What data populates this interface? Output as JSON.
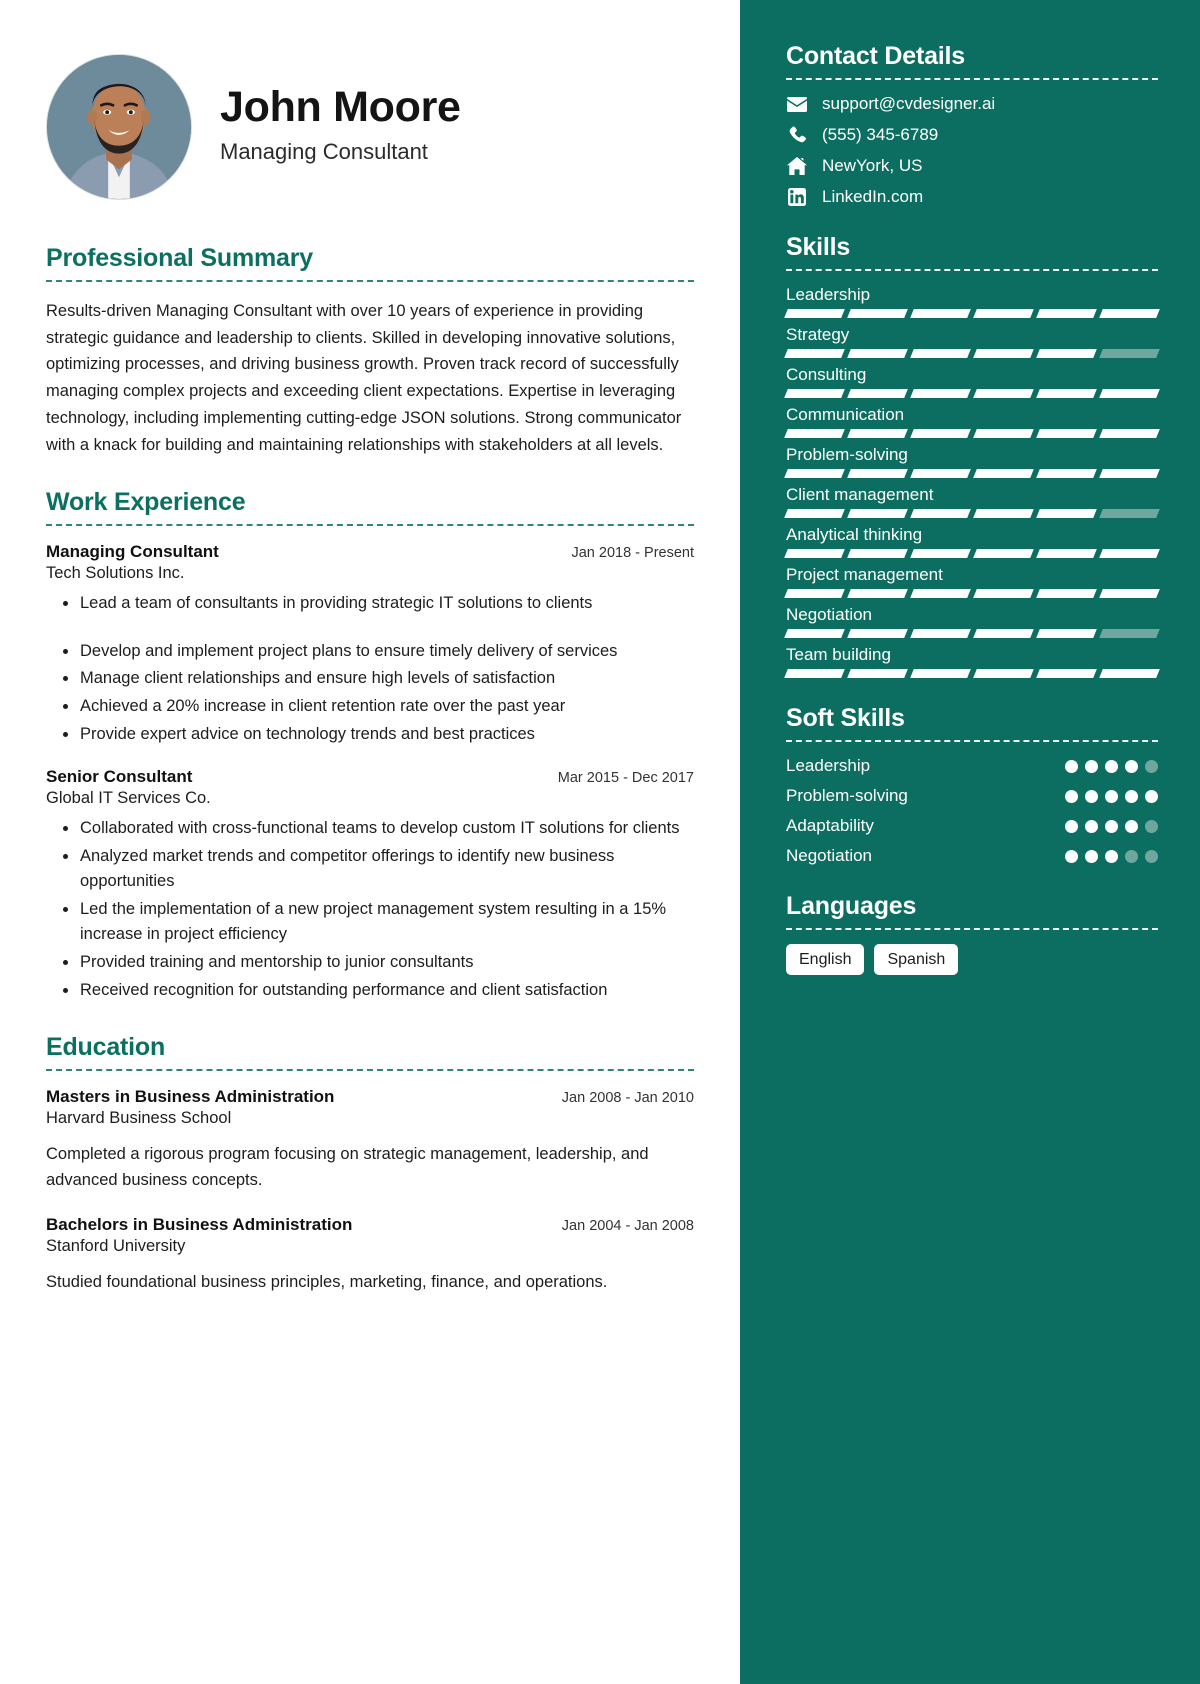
{
  "profile": {
    "name": "John Moore",
    "title": "Managing Consultant",
    "avatar_icon": "person-photo"
  },
  "summary": {
    "heading": "Professional Summary",
    "text": "Results-driven Managing Consultant with over 10 years of experience in providing strategic guidance and leadership to clients. Skilled in developing innovative solutions, optimizing processes, and driving business growth. Proven track record of successfully managing complex projects and exceeding client expectations. Expertise in leveraging technology, including implementing cutting-edge JSON solutions. Strong communicator with a knack for building and maintaining relationships with stakeholders at all levels."
  },
  "work": {
    "heading": "Work Experience",
    "jobs": [
      {
        "role": "Managing Consultant",
        "company": "Tech Solutions Inc.",
        "dates": "Jan 2018 - Present",
        "bullets": [
          "Lead a team of consultants in providing strategic IT solutions to clients",
          "Develop and implement project plans to ensure timely delivery of services",
          "Manage client relationships and ensure high levels of satisfaction",
          "Achieved a 20% increase in client retention rate over the past year",
          "Provide expert advice on technology trends and best practices"
        ]
      },
      {
        "role": "Senior Consultant",
        "company": "Global IT Services Co.",
        "dates": "Mar 2015 - Dec 2017",
        "bullets": [
          "Collaborated with cross-functional teams to develop custom IT solutions for clients",
          "Analyzed market trends and competitor offerings to identify new business opportunities",
          "Led the implementation of a new project management system resulting in a 15% increase in project efficiency",
          "Provided training and mentorship to junior consultants",
          "Received recognition for outstanding performance and client satisfaction"
        ]
      }
    ]
  },
  "education": {
    "heading": "Education",
    "items": [
      {
        "degree": "Masters in Business Administration",
        "school": "Harvard Business School",
        "dates": "Jan 2008 - Jan 2010",
        "description": "Completed a rigorous program focusing on strategic management, leadership, and advanced business concepts."
      },
      {
        "degree": "Bachelors in Business Administration",
        "school": "Stanford University",
        "dates": "Jan 2004 - Jan 2008",
        "description": "Studied foundational business principles, marketing, finance, and operations."
      }
    ]
  },
  "contact": {
    "heading": "Contact Details",
    "items": [
      {
        "icon": "envelope-icon",
        "value": "support@cvdesigner.ai"
      },
      {
        "icon": "phone-icon",
        "value": "(555) 345-6789"
      },
      {
        "icon": "home-icon",
        "value": "NewYork, US"
      },
      {
        "icon": "linkedin-icon",
        "value": "LinkedIn.com"
      }
    ]
  },
  "skills": {
    "heading": "Skills",
    "segments_total": 6,
    "items": [
      {
        "name": "Leadership",
        "filled": 6
      },
      {
        "name": "Strategy",
        "filled": 5
      },
      {
        "name": "Consulting",
        "filled": 6
      },
      {
        "name": "Communication",
        "filled": 6
      },
      {
        "name": "Problem-solving",
        "filled": 6
      },
      {
        "name": "Client management",
        "filled": 5
      },
      {
        "name": "Analytical thinking",
        "filled": 6
      },
      {
        "name": "Project management",
        "filled": 6
      },
      {
        "name": "Negotiation",
        "filled": 5
      },
      {
        "name": "Team building",
        "filled": 6
      }
    ]
  },
  "soft_skills": {
    "heading": "Soft Skills",
    "dots_total": 5,
    "items": [
      {
        "name": "Leadership",
        "rating": 4
      },
      {
        "name": "Problem-solving",
        "rating": 5
      },
      {
        "name": "Adaptability",
        "rating": 4
      },
      {
        "name": "Negotiation",
        "rating": 3
      }
    ]
  },
  "languages": {
    "heading": "Languages",
    "items": [
      "English",
      "Spanish"
    ]
  },
  "colors": {
    "accent": "#0c7061",
    "sidebar_bg": "#0c6e60",
    "segment_on": "#ffffff",
    "segment_off": "#6fa79e"
  }
}
